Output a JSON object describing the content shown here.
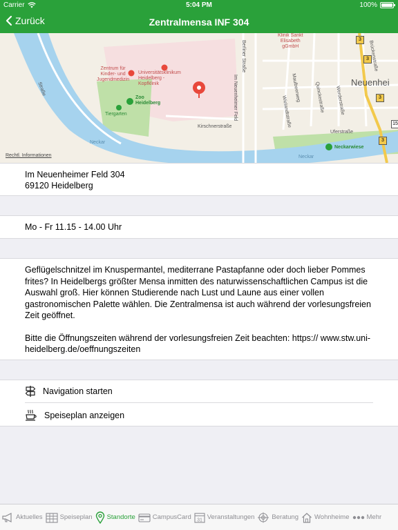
{
  "status": {
    "carrier": "Carrier",
    "time": "5:04 PM",
    "battery": "100%",
    "battery_level": 1.0
  },
  "nav": {
    "back_label": "Zurück",
    "title": "Zentralmensa INF 304"
  },
  "map": {
    "legal": "Rechtl. Informationen",
    "labels": {
      "strasse_left": "Straße",
      "kinderklinik": "Zentrum für\nKinder- und\nJugendmedizin",
      "uniklinik": "Universitätsklinikum\nHeidelberg -\nKopfklinik",
      "zoo": "Zoo\nHeidelberg",
      "tiergarten": "Tiergarten",
      "berliner": "Berliner Straße",
      "inf": "Im Neuenheimer Feld",
      "kirschner": "Kirschnerstraße",
      "klinik_sankt": "Klinik Sankt\nElisabeth\ngGmbH",
      "neuenheim": "Neuenhei",
      "neckar1": "Neckar",
      "neckar2": "Neckar",
      "neckarwiese": "Neckarwiese",
      "uferstrasse": "Uferstraße",
      "wielandt": "Wielandtstraße",
      "moench": "Mönchhofstraße",
      "maulbeer": "Maulbeerweg",
      "quincke": "Quinckestraße",
      "werder": "Werderstraße",
      "werderpl": "Werderstraße",
      "brueckenstr": "Brückenstraße",
      "uferstr2": "Uferstraße",
      "b3": "3",
      "b15": "15"
    }
  },
  "address": {
    "line1": "Im Neuenheimer Feld 304",
    "line2": "69120 Heidelberg"
  },
  "hours": "Mo - Fr 11.15 - 14.00 Uhr",
  "description": {
    "p1": "Geflügelschnitzel im Knuspermantel, mediterrane Pastapfanne oder doch lieber Pommes frites? In Heidelbergs größter Mensa inmitten des naturwissenschaftlichen Campus ist die Auswahl groß. Hier können Studierende nach Lust und Laune aus einer vollen gastronomischen Palette wählen. Die Zentralmensa ist auch während der vorlesungsfreien Zeit geöffnet.",
    "p2": "Bitte die Öffnungszeiten während der vorlesungsfreien Zeit beachten: https:// www.stw.uni-heidelberg.de/oeffnungszeiten"
  },
  "actions": {
    "navigate": "Navigation starten",
    "menu": "Speiseplan anzeigen"
  },
  "tabs": {
    "aktuelles": "Aktuelles",
    "speiseplan": "Speiseplan",
    "standorte": "Standorte",
    "campuscard": "CampusCard",
    "veranstaltungen": "Veranstaltungen",
    "calendar_day": "31",
    "beratung": "Beratung",
    "wohnheime": "Wohnheime",
    "mehr": "Mehr"
  },
  "colors": {
    "accent": "#2aa13a",
    "pin": "#e8483b",
    "river": "#a6d3ee",
    "park": "#bfe0a8"
  }
}
